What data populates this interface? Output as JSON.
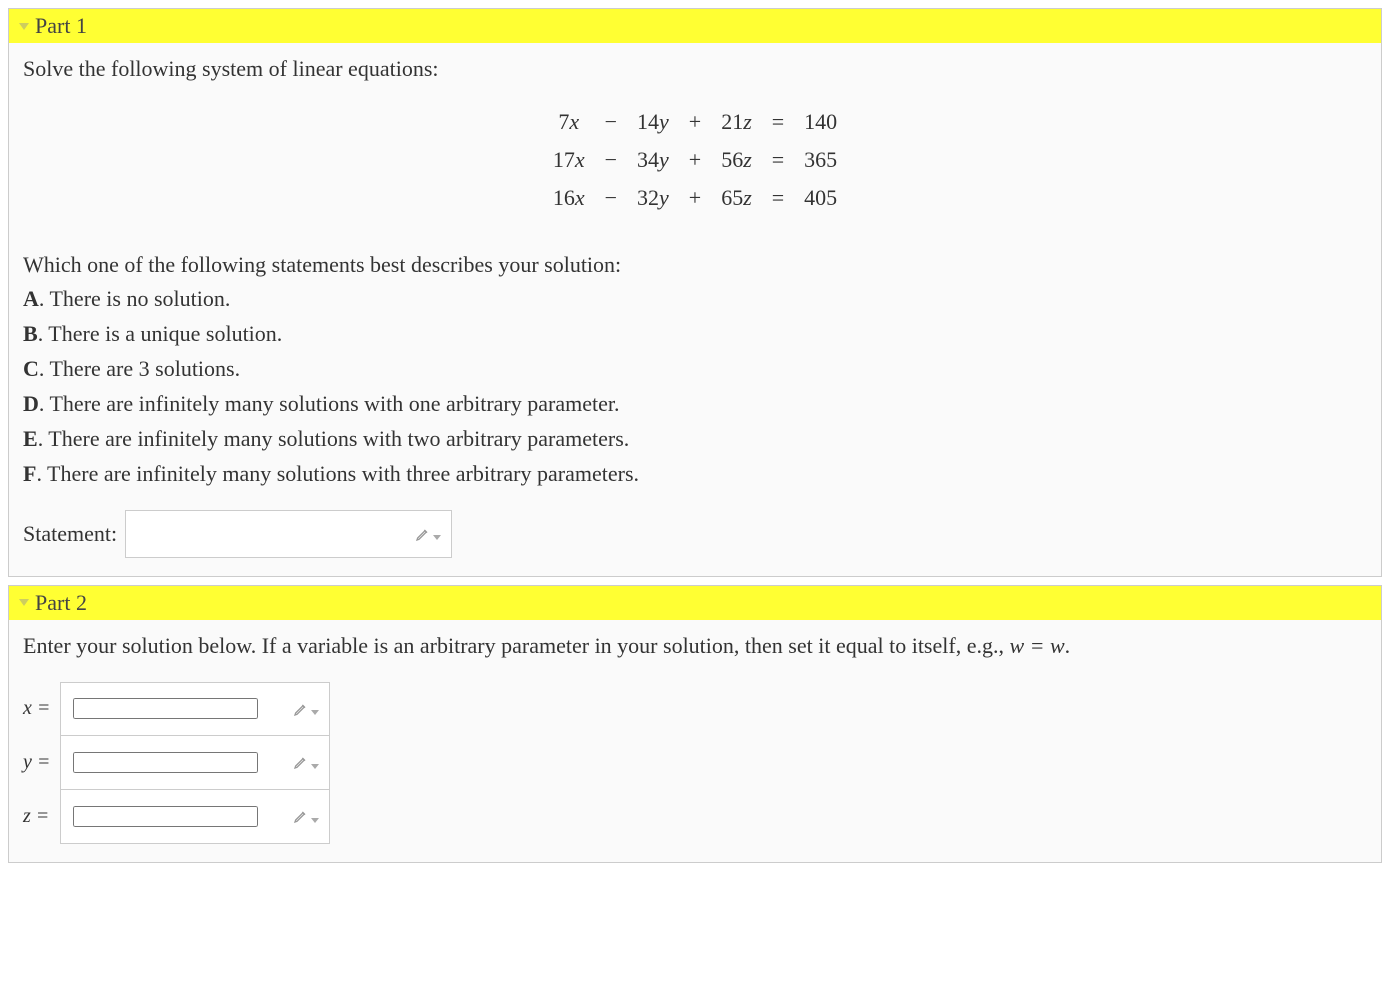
{
  "part1": {
    "title": "Part 1",
    "prompt": "Solve the following system of linear equations:",
    "equations": [
      {
        "c1": "7",
        "v1": "x",
        "op1": "−",
        "c2": "14",
        "v2": "y",
        "op2": "+",
        "c3": "21",
        "v3": "z",
        "eq": "=",
        "rhs": "140"
      },
      {
        "c1": "17",
        "v1": "x",
        "op1": "−",
        "c2": "34",
        "v2": "y",
        "op2": "+",
        "c3": "56",
        "v3": "z",
        "eq": "=",
        "rhs": "365"
      },
      {
        "c1": "16",
        "v1": "x",
        "op1": "−",
        "c2": "32",
        "v2": "y",
        "op2": "+",
        "c3": "65",
        "v3": "z",
        "eq": "=",
        "rhs": "405"
      }
    ],
    "question": "Which one of the following statements best describes your solution:",
    "options": [
      {
        "label": "A",
        "text": ". There is no solution."
      },
      {
        "label": "B",
        "text": ". There is a unique solution."
      },
      {
        "label": "C",
        "text": ". There are 3 solutions."
      },
      {
        "label": "D",
        "text": ". There are infinitely many solutions with one arbitrary parameter."
      },
      {
        "label": "E",
        "text": ". There are infinitely many solutions with two arbitrary parameters."
      },
      {
        "label": "F",
        "text": ". There are infinitely many solutions with three arbitrary parameters."
      }
    ],
    "statement_label": "Statement:",
    "statement_value": ""
  },
  "part2": {
    "title": "Part 2",
    "prompt_a": "Enter your solution below. If a variable is an arbitrary parameter in your solution, then set it equal to itself, e.g., ",
    "prompt_b": "w = w",
    "prompt_c": ".",
    "fields": [
      {
        "label": "x =",
        "value": ""
      },
      {
        "label": "y =",
        "value": ""
      },
      {
        "label": "z =",
        "value": ""
      }
    ]
  }
}
